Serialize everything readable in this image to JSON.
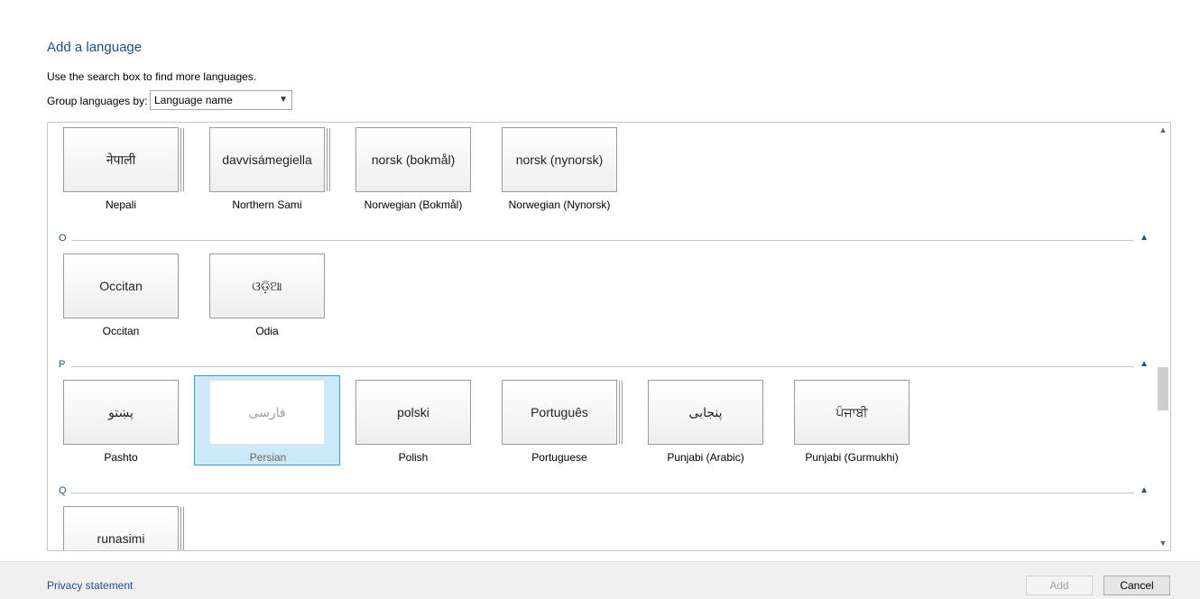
{
  "header": {
    "title": "Add a language",
    "hint": "Use the search box to find more languages.",
    "group_label": "Group languages by:",
    "group_value": "Language name"
  },
  "sections": [
    {
      "letter": "O"
    },
    {
      "letter": "P"
    },
    {
      "letter": "Q"
    }
  ],
  "tiles": [
    {
      "native": "नेपाली",
      "name": "Nepali"
    },
    {
      "native": "davvisámegiella",
      "name": "Northern Sami"
    },
    {
      "native": "norsk (bokmål)",
      "name": "Norwegian (Bokmål)"
    },
    {
      "native": "norsk (nynorsk)",
      "name": "Norwegian (Nynorsk)"
    },
    {
      "native": "Occitan",
      "name": "Occitan"
    },
    {
      "native": "ଓଡ଼ିଆ",
      "name": "Odia"
    },
    {
      "native": "پښتو",
      "name": "Pashto"
    },
    {
      "native": "فارسی",
      "name": "Persian"
    },
    {
      "native": "polski",
      "name": "Polish"
    },
    {
      "native": "Português",
      "name": "Portuguese"
    },
    {
      "native": "پنجابی",
      "name": "Punjabi (Arabic)"
    },
    {
      "native": "ਪੰਜਾਬੀ",
      "name": "Punjabi (Gurmukhi)"
    },
    {
      "native": "runasimi",
      "name": ""
    }
  ],
  "footer": {
    "privacy": "Privacy statement",
    "add": "Add",
    "cancel": "Cancel"
  },
  "colors": {
    "accent": "#1e4e8c",
    "selection": "#cde8f7",
    "selection_border": "#26a0da"
  }
}
